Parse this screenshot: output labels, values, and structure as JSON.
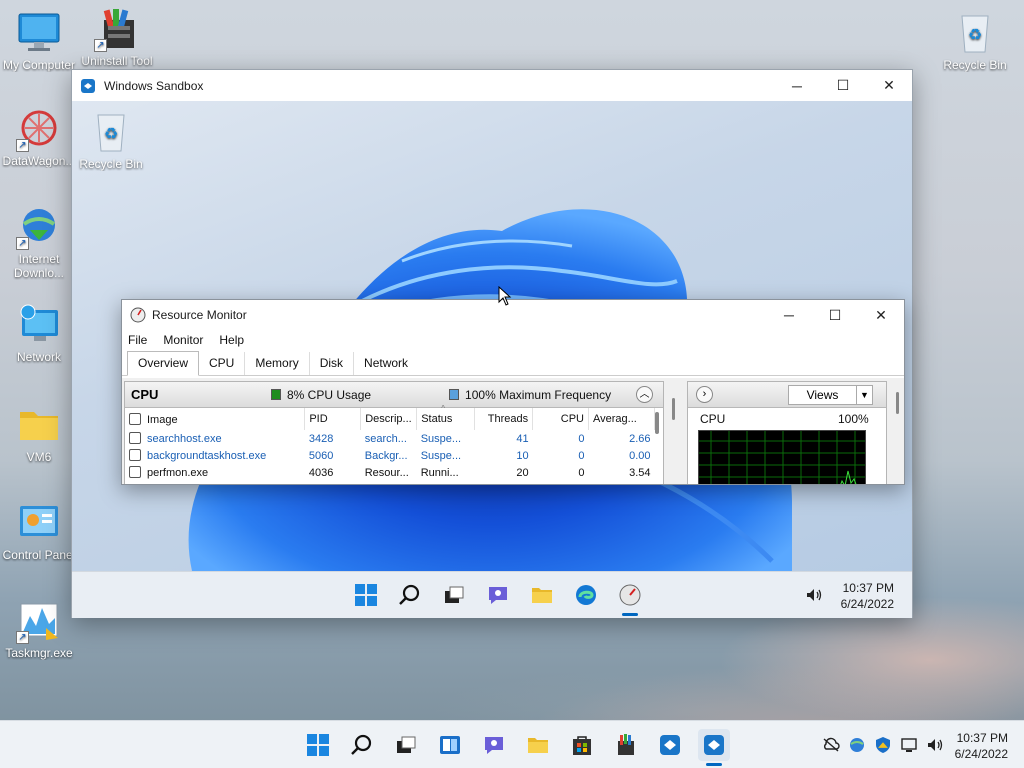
{
  "desktop": {
    "icons": [
      {
        "label": "My Computer",
        "icon": "computer-icon"
      },
      {
        "label": "Uninstall Tool",
        "icon": "uninstall-tool-icon"
      },
      {
        "label": "Recycle Bin",
        "icon": "recycle-bin-icon"
      },
      {
        "label": "DataWagon...",
        "icon": "datawagon-icon"
      },
      {
        "label": "Internet Downlo...",
        "icon": "internet-download-icon"
      },
      {
        "label": "Network",
        "icon": "network-icon"
      },
      {
        "label": "VM6",
        "icon": "folder-icon"
      },
      {
        "label": "Control Panel",
        "icon": "control-panel-icon"
      },
      {
        "label": "Taskmgr.exe",
        "icon": "taskmgr-icon"
      }
    ]
  },
  "sandbox": {
    "title": "Windows Sandbox",
    "desktop_icon_label": "Recycle Bin",
    "clock_time": "10:37 PM",
    "clock_date": "6/24/2022"
  },
  "resmon": {
    "title": "Resource Monitor",
    "menu": [
      "File",
      "Monitor",
      "Help"
    ],
    "tabs": [
      "Overview",
      "CPU",
      "Memory",
      "Disk",
      "Network"
    ],
    "active_tab": "Overview",
    "cpu_section": {
      "title": "CPU",
      "usage_legend": "8% CPU Usage",
      "freq_legend": "100% Maximum Frequency",
      "usage_color": "#1e8c1e",
      "freq_color": "#5aa0dc"
    },
    "columns": [
      "Image",
      "PID",
      "Descrip...",
      "Status",
      "Threads",
      "CPU",
      "Averag..."
    ],
    "rows": [
      {
        "image": "searchhost.exe",
        "pid": "3428",
        "desc": "search...",
        "status": "Suspe...",
        "threads": "41",
        "cpu": "0",
        "avg": "2.66"
      },
      {
        "image": "backgroundtaskhost.exe",
        "pid": "5060",
        "desc": "Backgr...",
        "status": "Suspe...",
        "threads": "10",
        "cpu": "0",
        "avg": "0.00"
      },
      {
        "image": "perfmon.exe",
        "pid": "4036",
        "desc": "Resour...",
        "status": "Runni...",
        "threads": "20",
        "cpu": "0",
        "avg": "3.54"
      }
    ],
    "graph": {
      "views_label": "Views",
      "label": "CPU",
      "max_label": "100%"
    }
  },
  "host_taskbar": {
    "clock_time": "10:37 PM",
    "clock_date": "6/24/2022"
  }
}
